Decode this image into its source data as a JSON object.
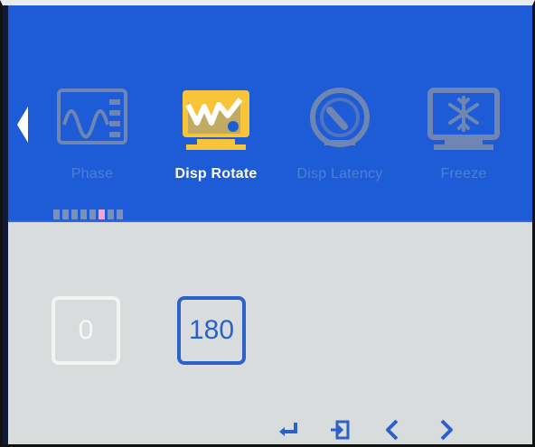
{
  "menu": {
    "items": [
      {
        "label": "Phase",
        "icon": "phase-waveform-icon",
        "active": false
      },
      {
        "label": "Disp Rotate",
        "icon": "display-rotate-icon",
        "active": true
      },
      {
        "label": "Disp Latency",
        "icon": "speedometer-icon",
        "active": false
      },
      {
        "label": "Freeze",
        "icon": "snowflake-monitor-icon",
        "active": false
      }
    ],
    "page_indicator": {
      "count": 8,
      "active_index": 5
    }
  },
  "options": [
    {
      "label": "0",
      "selected": false
    },
    {
      "label": "180",
      "selected": true
    }
  ],
  "bottom_controls": [
    {
      "icon": "enter-icon"
    },
    {
      "icon": "exit-icon"
    },
    {
      "icon": "chevron-left-icon"
    },
    {
      "icon": "chevron-right-icon"
    }
  ],
  "colors": {
    "header_blue": "#1e5bd6",
    "active_yellow": "#f7c43a",
    "inactive_icon": "#6f86b3",
    "selected_border": "#2b62c7"
  }
}
